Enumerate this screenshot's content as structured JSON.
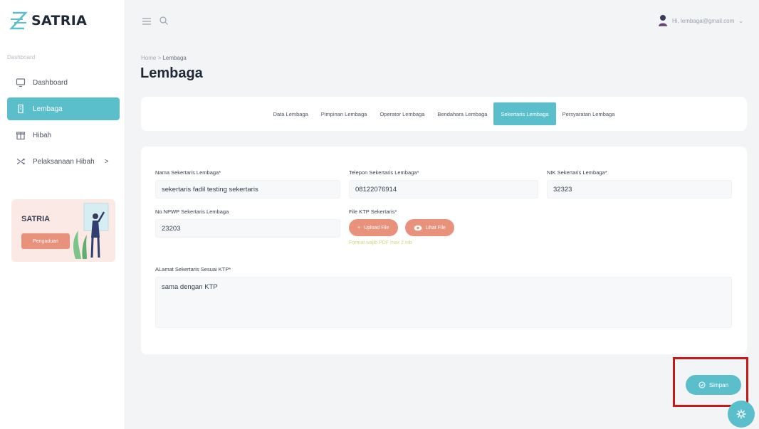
{
  "app": {
    "name": "SATRIA"
  },
  "sidebar": {
    "heading": "Dashboard",
    "items": [
      {
        "label": "Dashboard",
        "icon": "monitor-icon"
      },
      {
        "label": "Lembaga",
        "icon": "building-icon",
        "active": true
      },
      {
        "label": "Hibah",
        "icon": "gift-icon"
      },
      {
        "label": "Pelaksanaan Hibah",
        "icon": "shuffle-icon",
        "chevron": ">"
      }
    ],
    "promo": {
      "title": "SATRIA",
      "button": "Pengaduan"
    }
  },
  "topbar": {
    "user_text": "Hi, lembaga@gmail.com"
  },
  "breadcrumb": {
    "home": "Home",
    "separator": ">",
    "current": "Lembaga"
  },
  "page": {
    "title": "Lembaga"
  },
  "tabs": [
    {
      "label": "Data Lembaga"
    },
    {
      "label": "Pimpinan Lembaga"
    },
    {
      "label": "Operator Lembaga"
    },
    {
      "label": "Bendahara Lembaga"
    },
    {
      "label": "Sekertaris Lembaga",
      "active": true
    },
    {
      "label": "Persyaratan Lembaga"
    }
  ],
  "form": {
    "nama": {
      "label": "Nama Sekertaris Lembaga*",
      "value": "sekertaris fadil testing sekertaris"
    },
    "telepon": {
      "label": "Telepon Sekertaris Lembaga*",
      "value": "08122076914"
    },
    "nik": {
      "label": "NIK Sekertaris Lembaga*",
      "value": "32323"
    },
    "npwp": {
      "label": "No NPWP Sekertaris Lembaga",
      "value": "23203"
    },
    "ktp": {
      "label": "File KTP Sekertaris*",
      "upload_label": "Upload File",
      "view_label": "Lihat File",
      "hint": "Format wajib PDF max 2 mb"
    },
    "alamat": {
      "label": "ALamat Sekertaris Sesuai KTP*",
      "value": "sama dengan KTP"
    }
  },
  "actions": {
    "save_label": "Simpan"
  },
  "colors": {
    "accent": "#5bbfcb",
    "secondary": "#e8927c",
    "highlight": "#c41a1a"
  }
}
